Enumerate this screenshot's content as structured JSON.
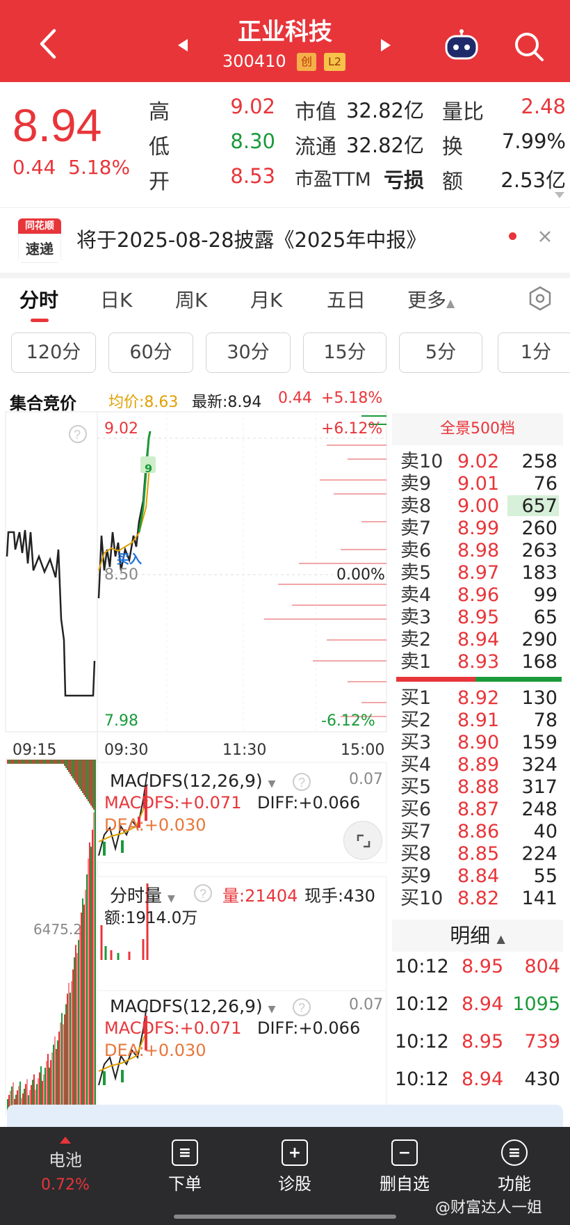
{
  "header": {
    "title": "正业科技",
    "code": "300410",
    "badge_market": "创",
    "badge_level": "L2"
  },
  "quote": {
    "price": "8.94",
    "change": "0.44",
    "change_pct": "5.18%",
    "rows": [
      {
        "l1": "高",
        "v1": "9.02",
        "l2": "市值",
        "v2": "32.82亿",
        "l3": "量比",
        "v3": "2.48"
      },
      {
        "l1": "低",
        "v1": "8.30",
        "l2": "流通",
        "v2": "32.82亿",
        "l3": "换",
        "v3": "7.99%"
      },
      {
        "l1": "开",
        "v1": "8.53",
        "l2": "市盈TTM",
        "v2": "亏损",
        "l3": "额",
        "v3": "2.53亿"
      }
    ]
  },
  "notice": {
    "logo_top": "同花顺",
    "logo_bottom": "速递",
    "text": "将于2025-08-28披露《2025年中报》"
  },
  "tabs": [
    "分时",
    "日K",
    "周K",
    "月K",
    "五日",
    "更多"
  ],
  "periods": [
    "120分",
    "60分",
    "30分",
    "15分",
    "5分",
    "1分"
  ],
  "auction": {
    "label": "集合竞价",
    "avg": "均价:8.63",
    "latest": "最新:8.94",
    "chg": "0.44",
    "chg_pct": "+5.18%"
  },
  "chart": {
    "price_high": "9.02",
    "price_low": "7.98",
    "pct_high": "+6.12%",
    "pct_mid": "0.00%",
    "pct_low": "-6.12%",
    "mid_price": "8.50",
    "buy_tag": "买入",
    "dot_label": "9",
    "times": [
      "09:15",
      "09:30",
      "11:30",
      "15:00"
    ],
    "auction_vol": "6475.2",
    "macd1": {
      "title": "MACDFS(12,26,9)",
      "right": "0.07",
      "macd": "MACDFS:+0.071",
      "diff": "DIFF:+0.066",
      "dea": "DEA:+0.030"
    },
    "volume": {
      "title": "分时量",
      "vol": "量:21404",
      "now": "现手:430",
      "amount": "额:1914.0万"
    },
    "macd2": {
      "title": "MACDFS(12,26,9)",
      "right": "0.07",
      "macd": "MACDFS:+0.071",
      "diff": "DIFF:+0.066",
      "dea": "DEA:+0.030"
    }
  },
  "orderbook": {
    "title": "全景500档",
    "asks": [
      {
        "label": "卖10",
        "price": "9.02",
        "vol": "258"
      },
      {
        "label": "卖9",
        "price": "9.01",
        "vol": "76"
      },
      {
        "label": "卖8",
        "price": "9.00",
        "vol": "657"
      },
      {
        "label": "卖7",
        "price": "8.99",
        "vol": "260"
      },
      {
        "label": "卖6",
        "price": "8.98",
        "vol": "263"
      },
      {
        "label": "卖5",
        "price": "8.97",
        "vol": "183"
      },
      {
        "label": "卖4",
        "price": "8.96",
        "vol": "99"
      },
      {
        "label": "卖3",
        "price": "8.95",
        "vol": "65"
      },
      {
        "label": "卖2",
        "price": "8.94",
        "vol": "290"
      },
      {
        "label": "卖1",
        "price": "8.93",
        "vol": "168"
      }
    ],
    "bids": [
      {
        "label": "买1",
        "price": "8.92",
        "vol": "130"
      },
      {
        "label": "买2",
        "price": "8.91",
        "vol": "78"
      },
      {
        "label": "买3",
        "price": "8.90",
        "vol": "159"
      },
      {
        "label": "买4",
        "price": "8.89",
        "vol": "324"
      },
      {
        "label": "买5",
        "price": "8.88",
        "vol": "317"
      },
      {
        "label": "买6",
        "price": "8.87",
        "vol": "248"
      },
      {
        "label": "买7",
        "price": "8.86",
        "vol": "40"
      },
      {
        "label": "买8",
        "price": "8.85",
        "vol": "224"
      },
      {
        "label": "买9",
        "price": "8.84",
        "vol": "55"
      },
      {
        "label": "买10",
        "price": "8.82",
        "vol": "141"
      }
    ],
    "detail_title": "明细",
    "details": [
      {
        "time": "10:12",
        "price": "8.95",
        "vol": "804"
      },
      {
        "time": "10:12",
        "price": "8.94",
        "vol": "1095"
      },
      {
        "time": "10:12",
        "price": "8.95",
        "vol": "739"
      },
      {
        "time": "10:12",
        "price": "8.94",
        "vol": "430"
      }
    ]
  },
  "bottom_nav": [
    {
      "label": "电池",
      "sub": "0.72%",
      "icon": "battery-icon"
    },
    {
      "label": "下单",
      "icon": "order-icon"
    },
    {
      "label": "诊股",
      "icon": "diagnose-icon"
    },
    {
      "label": "删自选",
      "icon": "remove-watchlist-icon"
    },
    {
      "label": "功能",
      "icon": "menu-icon"
    }
  ],
  "watermark": "@财富达人一姐",
  "colors": {
    "brand_red": "#e8353a",
    "up_red": "#e8353a",
    "down_green": "#1a9a3a",
    "nav_bg": "#2b2b2d"
  }
}
